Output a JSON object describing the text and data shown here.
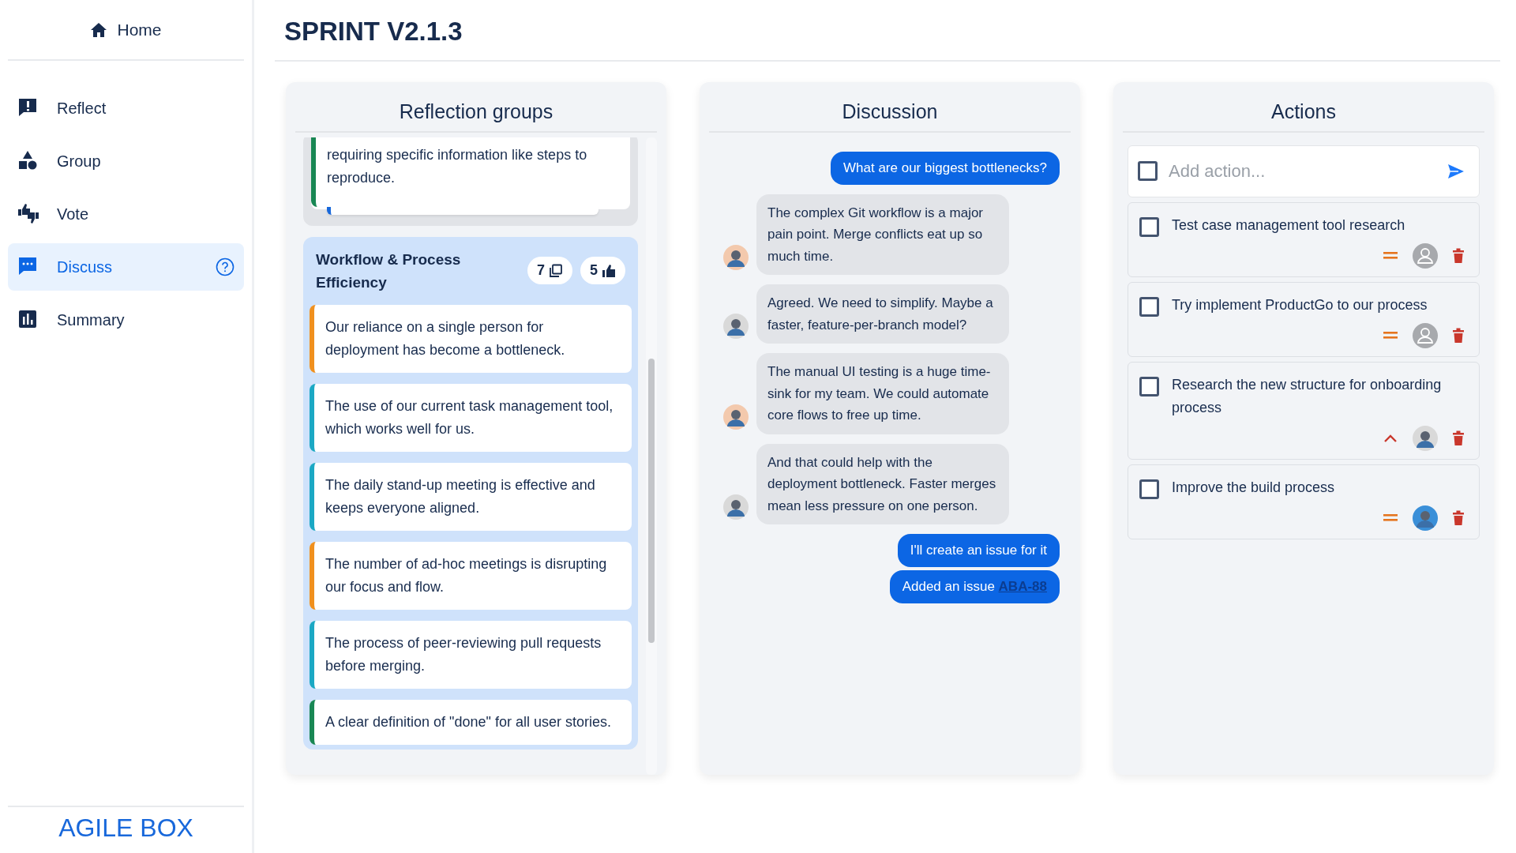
{
  "sidebar": {
    "home": "Home",
    "items": [
      {
        "label": "Reflect",
        "kind": "reflect",
        "selected": false,
        "help": false
      },
      {
        "label": "Group",
        "kind": "group",
        "selected": false,
        "help": false
      },
      {
        "label": "Vote",
        "kind": "vote",
        "selected": false,
        "help": false
      },
      {
        "label": "Discuss",
        "kind": "discuss",
        "selected": true,
        "help": true
      },
      {
        "label": "Summary",
        "kind": "summary",
        "selected": false,
        "help": false
      }
    ],
    "brand": "AGILE BOX"
  },
  "title": "SPRINT V2.1.3",
  "reflection": {
    "title": "Reflection groups",
    "groups": [
      {
        "kind": "stack",
        "cards": [
          {
            "text": "requiring specific information like steps to reproduce.",
            "color": "#198754"
          }
        ]
      },
      {
        "kind": "open",
        "title": "Workflow & Process Efficiency",
        "card_count": "7",
        "votes": "5",
        "cards": [
          {
            "text": "Our reliance on a single person for deployment has become a bottleneck.",
            "color": "#f0901e"
          },
          {
            "text": "The use of our current task management tool, which works well for us.",
            "color": "#1ba8c4"
          },
          {
            "text": "The daily stand-up meeting is effective and keeps everyone aligned.",
            "color": "#1ba8c4"
          },
          {
            "text": "The number of ad-hoc meetings is disrupting our focus and flow.",
            "color": "#f0901e"
          },
          {
            "text": "The process of peer-reviewing pull requests before merging.",
            "color": "#1ba8c4"
          },
          {
            "text": "A clear definition of \"done\" for all user stories.",
            "color": "#198754"
          }
        ]
      }
    ]
  },
  "discussion": {
    "title": "Discussion",
    "messages": [
      {
        "kind": "sent",
        "text": "What are our biggest bottlenecks?"
      },
      {
        "kind": "received",
        "color": "#f3c9ad",
        "text": "The complex Git workflow is a major pain point. Merge conflicts eat up so much time."
      },
      {
        "kind": "received",
        "color": "#d9d9d9",
        "text": "Agreed. We need to simplify. Maybe a faster, feature-per-branch model?"
      },
      {
        "kind": "received",
        "color": "#f3c9ad",
        "text": "The manual UI testing is a huge time-sink for my team. We could automate core flows to free up time."
      },
      {
        "kind": "received",
        "color": "#d9d9d9",
        "text": "And that could help with the deployment bottleneck. Faster merges mean less pressure on one person."
      },
      {
        "kind": "sent",
        "text": "I'll create an issue for it"
      },
      {
        "kind": "sent",
        "text": "Added an issue",
        "link": "ABA-88"
      }
    ]
  },
  "actions": {
    "title": "Actions",
    "add": {
      "placeholder": "Add action...",
      "checked": false
    },
    "items": [
      {
        "text": "Test case management tool research",
        "checked": false,
        "kind": "medium",
        "assigned": false
      },
      {
        "text": "Try implement ProductGo to our process",
        "checked": false,
        "kind": "medium",
        "assigned": false
      },
      {
        "text": "Research the new structure for onboarding process",
        "checked": false,
        "kind": "high",
        "assigned": true,
        "color": "#d9d9d9"
      },
      {
        "text": "Improve the build process",
        "checked": false,
        "kind": "medium",
        "assigned": true,
        "color": "#3a8fd8"
      }
    ]
  }
}
